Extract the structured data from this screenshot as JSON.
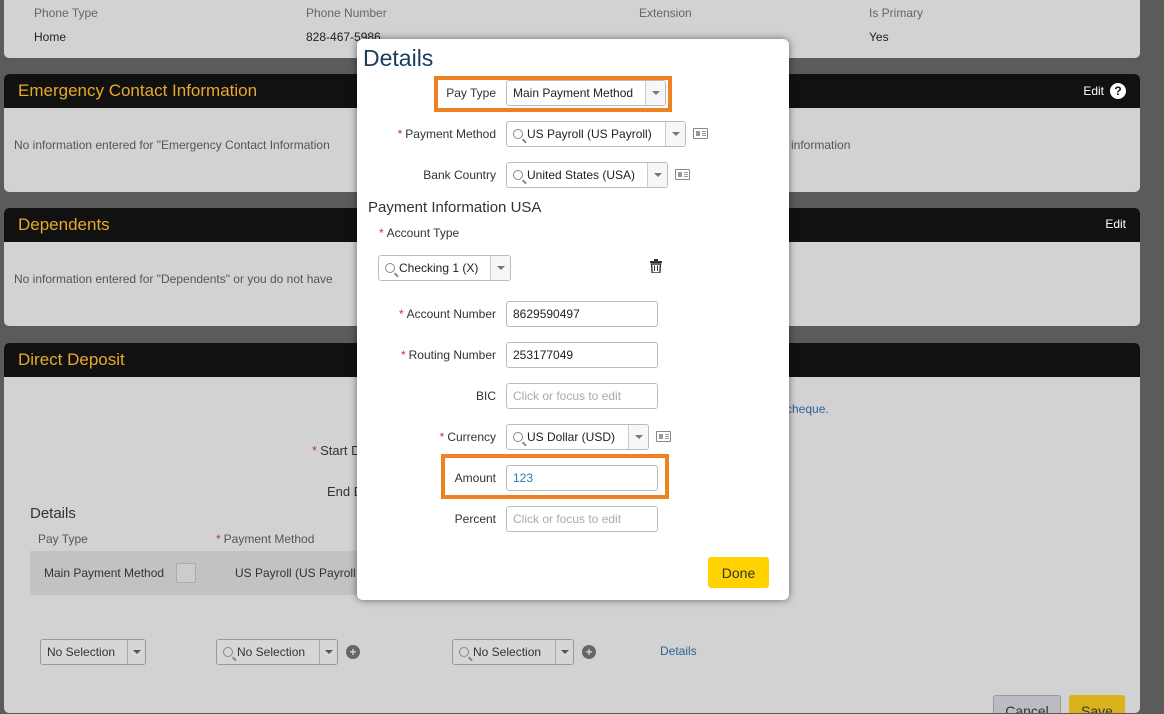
{
  "phones": {
    "headers": [
      "Phone Type",
      "Phone Number",
      "Extension",
      "Is Primary"
    ],
    "row": [
      "Home",
      "828-467-5986",
      "",
      "Yes"
    ]
  },
  "emergency": {
    "title": "Emergency Contact Information",
    "edit_label": "Edit",
    "message_left": "No information entered for \"Emergency Contact Information",
    "message_right": "information"
  },
  "dependents": {
    "title": "Dependents",
    "edit_label": "Edit",
    "message": "No information entered for \"Dependents\" or you do not have"
  },
  "direct_deposit": {
    "title": "Direct Deposit",
    "cheque_link": "cheque.",
    "start_label": "Start D",
    "end_label": "End D",
    "details_title": "Details",
    "col_pay_type": "Pay Type",
    "col_payment_method": "Payment Method",
    "row_pay_type": "Main Payment Method",
    "row_payment_method": "US Payroll (US Payroll",
    "new_row": {
      "pay_type": "No Selection",
      "payment_method": "No Selection",
      "third": "No Selection",
      "details_link": "Details"
    },
    "cancel_label": "Cancel",
    "save_label": "Save"
  },
  "modal": {
    "title": "Details",
    "pay_type_label": "Pay Type",
    "pay_type_value": "Main Payment Method",
    "payment_method_label": "Payment Method",
    "payment_method_value": "US Payroll (US Payroll)",
    "bank_country_label": "Bank Country",
    "bank_country_value": "United States (USA)",
    "section_title": "Payment Information USA",
    "account_type_label": "Account Type",
    "account_type_value": "Checking 1 (X)",
    "account_number_label": "Account Number",
    "account_number_value": "8629590497",
    "routing_number_label": "Routing Number",
    "routing_number_value": "253177049",
    "bic_label": "BIC",
    "bic_placeholder": "Click or focus to edit",
    "currency_label": "Currency",
    "currency_value": "US Dollar (USD)",
    "amount_label": "Amount",
    "amount_value": "123",
    "percent_label": "Percent",
    "percent_placeholder": "Click or focus to edit",
    "done_label": "Done"
  },
  "colors": {
    "highlight": "#f08120",
    "done_button": "#ffd200",
    "header_text": "#e8a92b"
  }
}
